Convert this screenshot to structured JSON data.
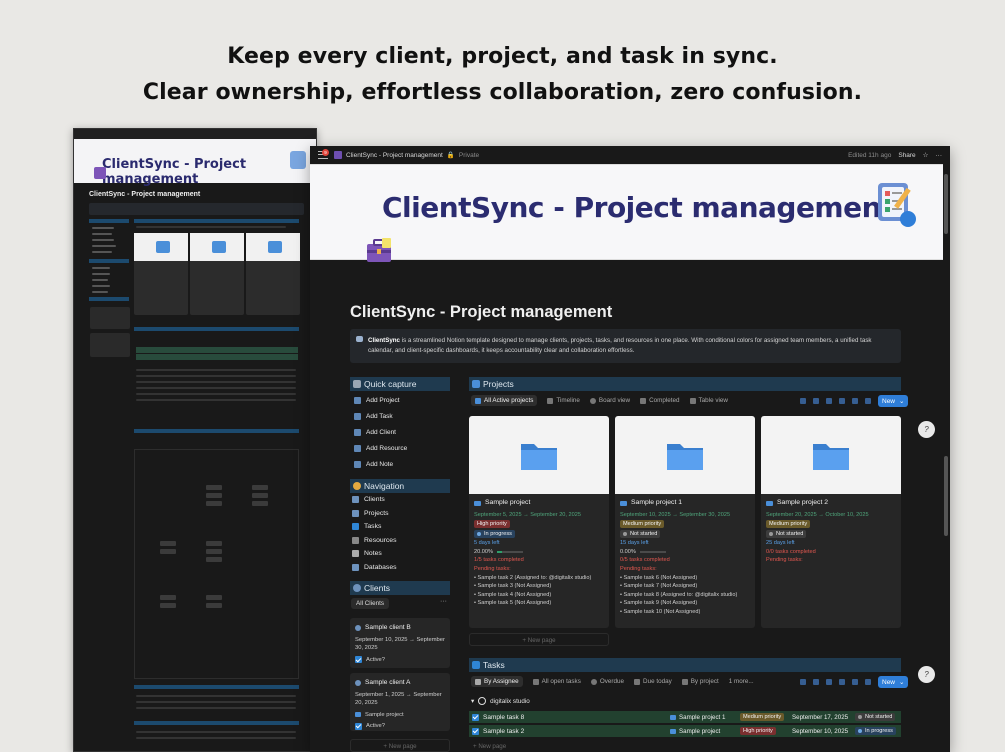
{
  "headline": {
    "line1": "Keep every client, project, and task in sync.",
    "line2": "Clear ownership, effortless collaboration, zero confusion."
  },
  "topbar": {
    "notif_count": "9",
    "page_name": "ClientSync - Project management",
    "privacy": "Private",
    "edited": "Edited 11h ago",
    "share": "Share"
  },
  "cover": {
    "title": "ClientSync - Project management"
  },
  "page": {
    "title": "ClientSync - Project management",
    "callout_brand": "ClientSync",
    "callout_text": " is a streamlined Notion template designed to manage clients, projects, tasks, and resources in one place. With conditional colors for assigned team members, a unified task calendar, and client-specific dashboards, it keeps accountability clear and collaboration effortless."
  },
  "quick_capture": {
    "title": "Quick capture",
    "items": [
      "Add Project",
      "Add Task",
      "Add Client",
      "Add Resource",
      "Add Note"
    ]
  },
  "navigation": {
    "title": "Navigation",
    "items": [
      "Clients",
      "Projects",
      "Tasks",
      "Resources",
      "Notes",
      "Databases"
    ]
  },
  "clients": {
    "title": "Clients",
    "tab": "All Clients",
    "more": "···",
    "cards": [
      {
        "name": "Sample client B",
        "dates": "September 10, 2025 → September 30, 2025",
        "status": "Active?"
      },
      {
        "name": "Sample client A",
        "dates": "September 1, 2025 → September 20, 2025",
        "project": "Sample project",
        "status": "Active?"
      }
    ],
    "new_page": "+ New page"
  },
  "projects": {
    "title": "Projects",
    "tabs": [
      "All Active projects",
      "Timeline",
      "Board view",
      "Completed",
      "Table view"
    ],
    "new_label": "New",
    "cards": [
      {
        "name": "Sample project",
        "dates": "September 5, 2025 → September 20, 2025",
        "priority": "High priority",
        "status": "In progress",
        "days_left": "5 days left",
        "percent": "20.00%",
        "progress": 0.2,
        "tasks_completed": "1/5 tasks completed",
        "pending_label": "Pending tasks:",
        "pending": [
          "• Sample task 2 (Assigned to: @digitalix studio)",
          "• Sample task 3 (Not Assigned)",
          "• Sample task 4 (Not Assigned)",
          "• Sample task 5 (Not Assigned)"
        ]
      },
      {
        "name": "Sample project 1",
        "dates": "September 10, 2025 → September 30, 2025",
        "priority": "Medium priority",
        "status": "Not started",
        "days_left": "15 days left",
        "percent": "0.00%",
        "progress": 0,
        "tasks_completed": "0/5 tasks completed",
        "pending_label": "Pending tasks:",
        "pending": [
          "• Sample task 6 (Not Assigned)",
          "• Sample task 7 (Not Assigned)",
          "• Sample task 8 (Assigned to: @digitalix studio)",
          "• Sample task 9 (Not Assigned)",
          "• Sample task 10 (Not Assigned)"
        ]
      },
      {
        "name": "Sample project 2",
        "dates": "September 20, 2025 → October 10, 2025",
        "priority": "Medium priority",
        "status": "Not started",
        "days_left": "25 days left",
        "percent": "",
        "progress": 0,
        "tasks_completed": "0/0 tasks completed",
        "pending_label": "Pending tasks:",
        "pending": []
      }
    ],
    "new_page": "+ New page"
  },
  "tasks": {
    "title": "Tasks",
    "tabs": [
      "By Assignee",
      "All open tasks",
      "Overdue",
      "Due today",
      "By project",
      "1 more..."
    ],
    "new_label": "New",
    "group": "digitalix studio",
    "rows": [
      {
        "name": "Sample task 8",
        "project": "Sample project 1",
        "priority": "Medium priority",
        "date": "September 17, 2025",
        "status": "Not started"
      },
      {
        "name": "Sample task 2",
        "project": "Sample project",
        "priority": "High priority",
        "date": "September 10, 2025",
        "status": "In progress"
      }
    ],
    "new_page": "+ New page"
  },
  "thumbnail": {
    "cover_title": "ClientSync - Project management",
    "page_title": "ClientSync - Project management"
  },
  "side_circle": "?",
  "colors": {
    "section_header": "#1f3a4f",
    "accent_blue": "#2f7ed8",
    "green_dates": "#4fa57b",
    "red": "#e0574f"
  }
}
